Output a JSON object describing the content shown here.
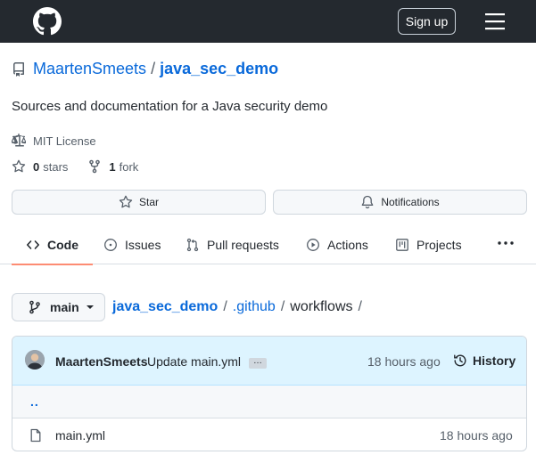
{
  "header": {
    "signup_label": "Sign up",
    "logo_icon": "github-mark-icon",
    "menu_icon": "hamburger-icon"
  },
  "repo": {
    "owner": "MaartenSmeets",
    "separator": "/",
    "name": "java_sec_demo",
    "description": "Sources and documentation for a Java security demo",
    "license": "MIT License",
    "stars_count": "0",
    "stars_label": "stars",
    "forks_count": "1",
    "forks_label": "fork"
  },
  "actions": {
    "star_label": "Star",
    "notifications_label": "Notifications"
  },
  "tabs": [
    {
      "label": "Code",
      "icon": "code-icon",
      "active": true
    },
    {
      "label": "Issues",
      "icon": "issue-icon"
    },
    {
      "label": "Pull requests",
      "icon": "pull-request-icon"
    },
    {
      "label": "Actions",
      "icon": "play-icon"
    },
    {
      "label": "Projects",
      "icon": "project-icon"
    }
  ],
  "branch": {
    "name": "main"
  },
  "breadcrumb": {
    "repo": "java_sec_demo",
    "folder": ".github",
    "current": "workflows",
    "sep": "/"
  },
  "commit": {
    "author": "MaartenSmeets",
    "message": "Update main.yml",
    "ellipsis": "…",
    "time": "18 hours ago",
    "history_label": "History"
  },
  "files": {
    "parent_link": "..",
    "items": [
      {
        "name": "main.yml",
        "time": "18 hours ago"
      }
    ]
  },
  "colors": {
    "header_bg": "#24292f",
    "link": "#0969da",
    "tab_underline": "#fd8c73",
    "commit_bg": "#ddf4ff"
  }
}
